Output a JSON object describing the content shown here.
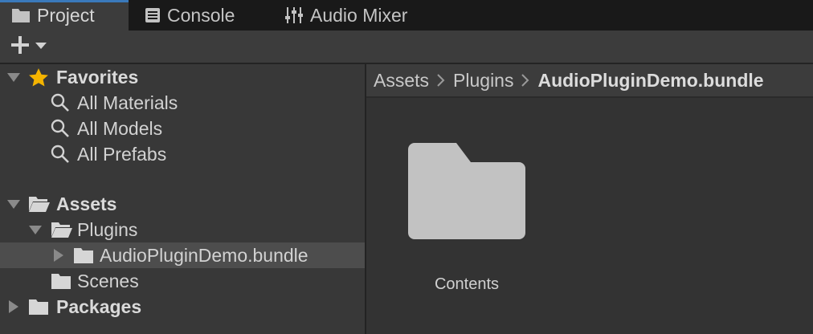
{
  "tabs": [
    {
      "label": "Project",
      "icon": "folder-icon",
      "active": true
    },
    {
      "label": "Console",
      "icon": "console-icon",
      "active": false
    },
    {
      "label": "Audio Mixer",
      "icon": "mixer-icon",
      "active": false
    }
  ],
  "toolbar": {
    "create_icon": "plus-icon",
    "dropdown_icon": "chevron-down-icon"
  },
  "tree": {
    "favorites": {
      "label": "Favorites",
      "items": [
        "All Materials",
        "All Models",
        "All Prefabs"
      ]
    },
    "assets": {
      "label": "Assets",
      "plugins": "Plugins",
      "bundle": "AudioPluginDemo.bundle",
      "scenes": "Scenes"
    },
    "packages": "Packages"
  },
  "breadcrumb": [
    "Assets",
    "Plugins",
    "AudioPluginDemo.bundle"
  ],
  "grid": {
    "items": [
      {
        "label": "Contents",
        "icon": "folder-icon"
      }
    ]
  },
  "colors": {
    "accent": "#3a79bb",
    "star": "#f4b400",
    "folder": "#c2c2c2"
  }
}
